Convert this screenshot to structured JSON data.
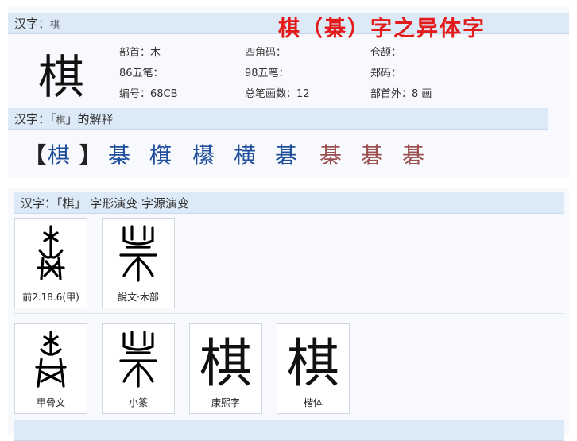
{
  "panel1": {
    "header_label": "汉字：",
    "header_char": "棋",
    "title_overlay": "棋（棊）字之异体字",
    "main_char": "棋",
    "info": {
      "bushou": "部首：木",
      "sijiao": "四角码：",
      "cangjie": "仓颉：",
      "wubi86": "86五笔：",
      "wubi98": "98五笔：",
      "zhengma": "郑码：",
      "code": "编号：68CB",
      "strokes": "总笔画数：12",
      "extra_strokes": "部首外：8 画"
    },
    "explain_prefix": "汉字：「",
    "explain_char": "棋",
    "explain_suffix": "」的解释",
    "variants_open": "【",
    "variants_main": "棋",
    "variants_close": "】",
    "variants": [
      "棊",
      "檱",
      "櫀",
      "横",
      "碁",
      "棊",
      "碁",
      "碁"
    ]
  },
  "panel2": {
    "header": "汉字：「棋」 字形演变 字源演变",
    "row1": [
      {
        "caption": "前2.18.6(甲)",
        "glyph": "oracle-bone-variant-1"
      },
      {
        "caption": "說文·木部",
        "glyph": "small-seal-shuowen"
      }
    ],
    "row2": [
      {
        "caption": "甲骨文",
        "glyph": "oracle-bone-script"
      },
      {
        "caption": "小篆",
        "glyph": "small-seal-script"
      },
      {
        "caption": "康熙字",
        "glyph": "棋"
      },
      {
        "caption": "楷体",
        "glyph": "棋"
      }
    ]
  },
  "colors": {
    "header_bar": "#dce9f7",
    "panel_bg": "#f7f9fc",
    "variant_blue": "#1f4e9c",
    "variant_brown": "#9b4f4f",
    "title_red": "#e41b1b"
  }
}
